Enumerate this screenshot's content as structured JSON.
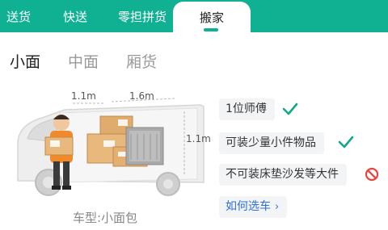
{
  "service_tabs": {
    "items": [
      "送货",
      "快送",
      "零担拼货"
    ],
    "active": "搬家"
  },
  "size_tabs": {
    "items": [
      "小面",
      "中面",
      "厢货"
    ],
    "active_index": 0
  },
  "van": {
    "dims": [
      "1.1m",
      "1.6m",
      "1.1m"
    ],
    "caption": "车型:小面包"
  },
  "features": [
    {
      "text": "1位师傅",
      "icon": "check-icon"
    },
    {
      "text": "可装少量小件物品",
      "icon": "check-icon"
    },
    {
      "text": "不可装床垫沙发等大件",
      "icon": "prohibited-icon"
    }
  ],
  "how_to_choose": {
    "label": "如何选车",
    "chevron": "›"
  },
  "colors": {
    "brand": "#10b193",
    "check": "#13a889",
    "prohibited": "#e8453c",
    "link": "#2f6fd6"
  }
}
